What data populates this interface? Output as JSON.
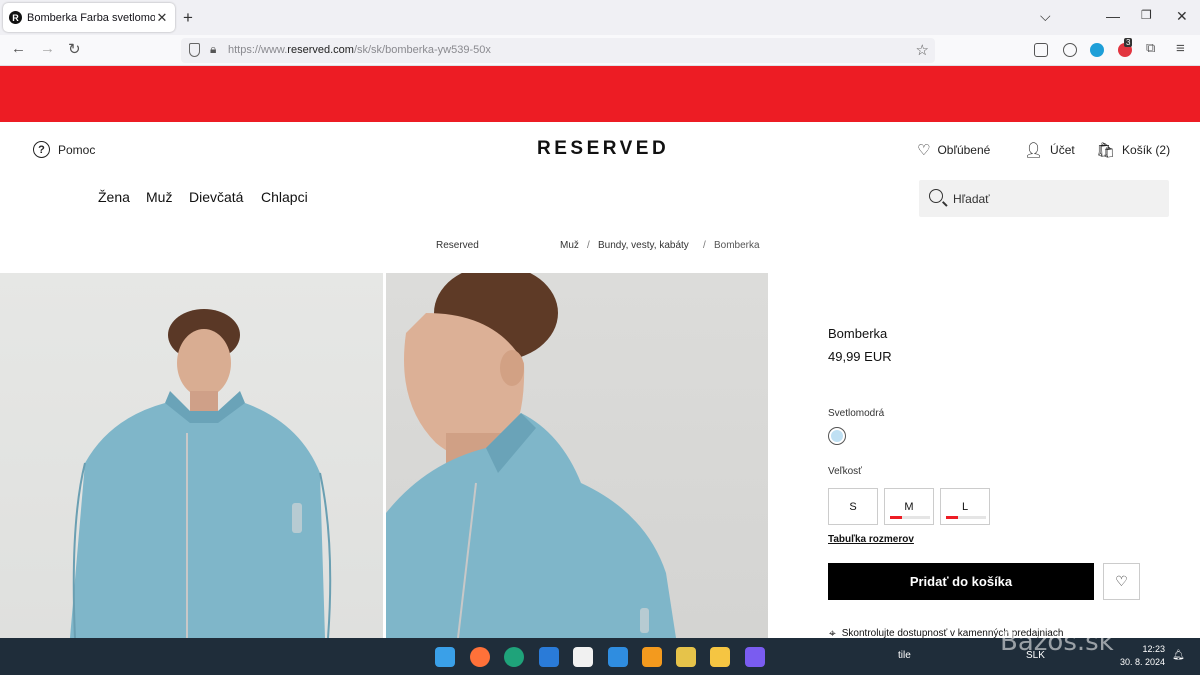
{
  "browser": {
    "tab_title": "Bomberka Farba svetlomodrá -",
    "tab_favicon": "R",
    "url_prefix": "https://www.",
    "url_domain": "reserved.com",
    "url_path": "/sk/sk/bomberka-yw539-50x",
    "extension_badge": "3"
  },
  "header": {
    "help_label": "Pomoc",
    "logo": "RESERVED",
    "favorites_label": "Obľúbené",
    "account_label": "Účet",
    "cart_label": "Košík (2)",
    "menu": [
      "Žena",
      "Muž",
      "Dievčatá",
      "Chlapci"
    ],
    "search_placeholder": "Hľadať"
  },
  "breadcrumb": {
    "brand": "Reserved",
    "items": [
      "Muž",
      "Bundy, vesty, kabáty",
      "Bomberka"
    ]
  },
  "product": {
    "name": "Bomberka",
    "price": "49,99 EUR",
    "color_name": "Svetlomodrá",
    "color_hex": "#bfe0f3",
    "size_label": "Veľkosť",
    "sizes": [
      {
        "label": "S",
        "low_stock": null
      },
      {
        "label": "M",
        "low_stock": 0.3
      },
      {
        "label": "L",
        "low_stock": 0.3
      }
    ],
    "size_table_label": "Tabuľka rozmerov",
    "add_to_cart_label": "Pridať do košíka",
    "availability_label": "Skontrolujte dostupnosť v kamenných predajniach"
  },
  "taskbar": {
    "lang": "SLK",
    "time": "12:23",
    "date": "30. 8. 2024",
    "tray_label": "tile"
  },
  "watermark": "Bazos.sk",
  "colors": {
    "banner": "#ed1c24",
    "accent": "#000000"
  }
}
